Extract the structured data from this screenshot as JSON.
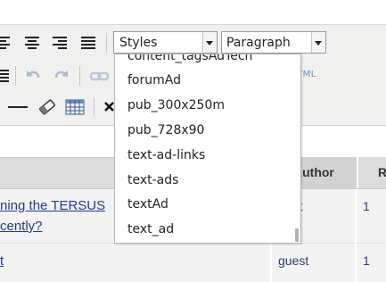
{
  "toolbar": {
    "styles_select": {
      "value": "Styles"
    },
    "paragraph_select": {
      "value": "Paragraph"
    },
    "html_button_label": "HTML"
  },
  "styles_dropdown": {
    "items": [
      "content_tagsAdTech",
      "forumAd",
      "pub_300x250m",
      "pub_728x90",
      "text-ad-links",
      "text-ads",
      "textAd",
      "text_ad"
    ]
  },
  "table": {
    "headers": [
      "Author",
      "R"
    ],
    "rows": [
      {
        "topic_line1": "ning the TERSUS",
        "topic_line2": "cently?",
        "author": "uest",
        "replies": "1"
      },
      {
        "topic_line1": "t",
        "author": "guest",
        "replies": "1"
      }
    ]
  },
  "colors": {
    "toolbar_bg": "#f0f0ee",
    "link": "#1f3c87",
    "header_bg": "#dcdcdc"
  }
}
